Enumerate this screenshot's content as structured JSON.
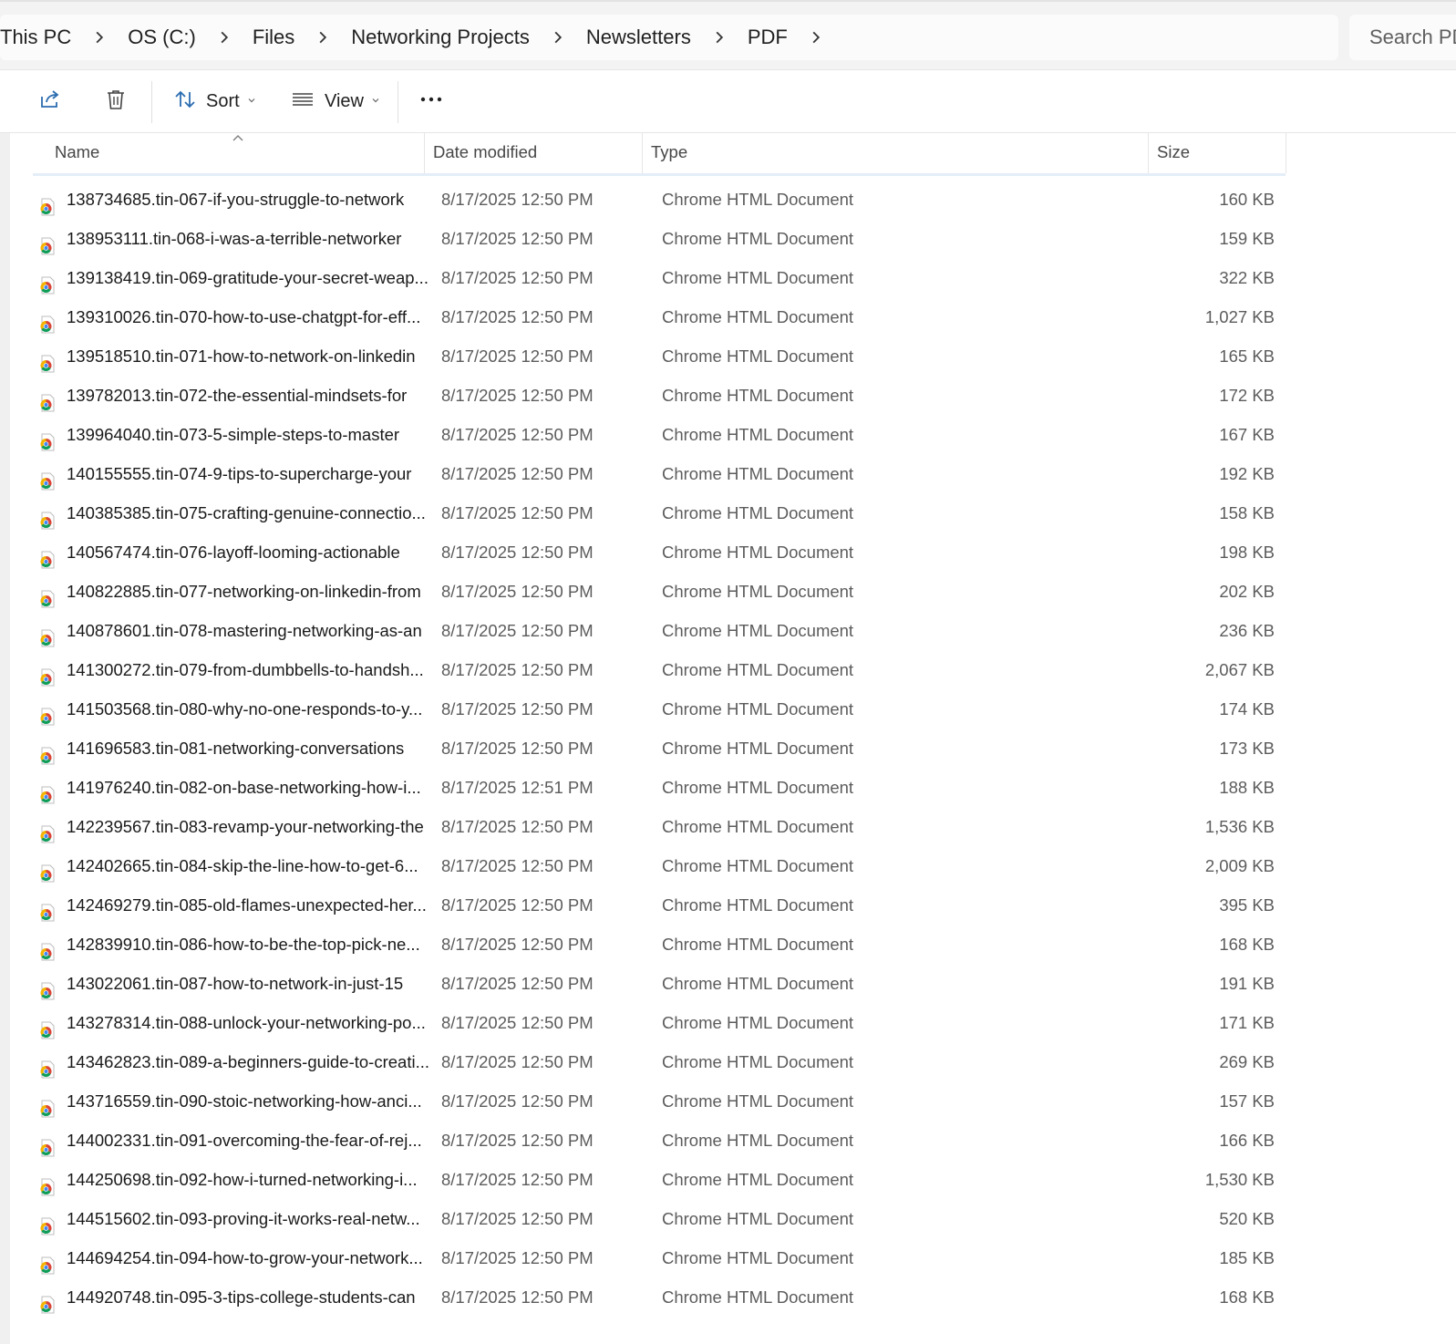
{
  "breadcrumb": [
    "This PC",
    "OS (C:)",
    "Files",
    "Networking Projects",
    "Newsletters",
    "PDF"
  ],
  "search": {
    "placeholder": "Search PDF"
  },
  "toolbar": {
    "sort_label": "Sort",
    "view_label": "View"
  },
  "columns": {
    "name": "Name",
    "date": "Date modified",
    "type": "Type",
    "size": "Size"
  },
  "files": [
    {
      "name": "138734685.tin-067-if-you-struggle-to-network",
      "date": "8/17/2025 12:50 PM",
      "type": "Chrome HTML Document",
      "size": "160 KB"
    },
    {
      "name": "138953111.tin-068-i-was-a-terrible-networker",
      "date": "8/17/2025 12:50 PM",
      "type": "Chrome HTML Document",
      "size": "159 KB"
    },
    {
      "name": "139138419.tin-069-gratitude-your-secret-weap...",
      "date": "8/17/2025 12:50 PM",
      "type": "Chrome HTML Document",
      "size": "322 KB"
    },
    {
      "name": "139310026.tin-070-how-to-use-chatgpt-for-eff...",
      "date": "8/17/2025 12:50 PM",
      "type": "Chrome HTML Document",
      "size": "1,027 KB"
    },
    {
      "name": "139518510.tin-071-how-to-network-on-linkedin",
      "date": "8/17/2025 12:50 PM",
      "type": "Chrome HTML Document",
      "size": "165 KB"
    },
    {
      "name": "139782013.tin-072-the-essential-mindsets-for",
      "date": "8/17/2025 12:50 PM",
      "type": "Chrome HTML Document",
      "size": "172 KB"
    },
    {
      "name": "139964040.tin-073-5-simple-steps-to-master",
      "date": "8/17/2025 12:50 PM",
      "type": "Chrome HTML Document",
      "size": "167 KB"
    },
    {
      "name": "140155555.tin-074-9-tips-to-supercharge-your",
      "date": "8/17/2025 12:50 PM",
      "type": "Chrome HTML Document",
      "size": "192 KB"
    },
    {
      "name": "140385385.tin-075-crafting-genuine-connectio...",
      "date": "8/17/2025 12:50 PM",
      "type": "Chrome HTML Document",
      "size": "158 KB"
    },
    {
      "name": "140567474.tin-076-layoff-looming-actionable",
      "date": "8/17/2025 12:50 PM",
      "type": "Chrome HTML Document",
      "size": "198 KB"
    },
    {
      "name": "140822885.tin-077-networking-on-linkedin-from",
      "date": "8/17/2025 12:50 PM",
      "type": "Chrome HTML Document",
      "size": "202 KB"
    },
    {
      "name": "140878601.tin-078-mastering-networking-as-an",
      "date": "8/17/2025 12:50 PM",
      "type": "Chrome HTML Document",
      "size": "236 KB"
    },
    {
      "name": "141300272.tin-079-from-dumbbells-to-handsh...",
      "date": "8/17/2025 12:50 PM",
      "type": "Chrome HTML Document",
      "size": "2,067 KB"
    },
    {
      "name": "141503568.tin-080-why-no-one-responds-to-y...",
      "date": "8/17/2025 12:50 PM",
      "type": "Chrome HTML Document",
      "size": "174 KB"
    },
    {
      "name": "141696583.tin-081-networking-conversations",
      "date": "8/17/2025 12:50 PM",
      "type": "Chrome HTML Document",
      "size": "173 KB"
    },
    {
      "name": "141976240.tin-082-on-base-networking-how-i...",
      "date": "8/17/2025 12:51 PM",
      "type": "Chrome HTML Document",
      "size": "188 KB"
    },
    {
      "name": "142239567.tin-083-revamp-your-networking-the",
      "date": "8/17/2025 12:50 PM",
      "type": "Chrome HTML Document",
      "size": "1,536 KB"
    },
    {
      "name": "142402665.tin-084-skip-the-line-how-to-get-6...",
      "date": "8/17/2025 12:50 PM",
      "type": "Chrome HTML Document",
      "size": "2,009 KB"
    },
    {
      "name": "142469279.tin-085-old-flames-unexpected-her...",
      "date": "8/17/2025 12:50 PM",
      "type": "Chrome HTML Document",
      "size": "395 KB"
    },
    {
      "name": "142839910.tin-086-how-to-be-the-top-pick-ne...",
      "date": "8/17/2025 12:50 PM",
      "type": "Chrome HTML Document",
      "size": "168 KB"
    },
    {
      "name": "143022061.tin-087-how-to-network-in-just-15",
      "date": "8/17/2025 12:50 PM",
      "type": "Chrome HTML Document",
      "size": "191 KB"
    },
    {
      "name": "143278314.tin-088-unlock-your-networking-po...",
      "date": "8/17/2025 12:50 PM",
      "type": "Chrome HTML Document",
      "size": "171 KB"
    },
    {
      "name": "143462823.tin-089-a-beginners-guide-to-creati...",
      "date": "8/17/2025 12:50 PM",
      "type": "Chrome HTML Document",
      "size": "269 KB"
    },
    {
      "name": "143716559.tin-090-stoic-networking-how-anci...",
      "date": "8/17/2025 12:50 PM",
      "type": "Chrome HTML Document",
      "size": "157 KB"
    },
    {
      "name": "144002331.tin-091-overcoming-the-fear-of-rej...",
      "date": "8/17/2025 12:50 PM",
      "type": "Chrome HTML Document",
      "size": "166 KB"
    },
    {
      "name": "144250698.tin-092-how-i-turned-networking-i...",
      "date": "8/17/2025 12:50 PM",
      "type": "Chrome HTML Document",
      "size": "1,530 KB"
    },
    {
      "name": "144515602.tin-093-proving-it-works-real-netw...",
      "date": "8/17/2025 12:50 PM",
      "type": "Chrome HTML Document",
      "size": "520 KB"
    },
    {
      "name": "144694254.tin-094-how-to-grow-your-network...",
      "date": "8/17/2025 12:50 PM",
      "type": "Chrome HTML Document",
      "size": "185 KB"
    },
    {
      "name": "144920748.tin-095-3-tips-college-students-can",
      "date": "8/17/2025 12:50 PM",
      "type": "Chrome HTML Document",
      "size": "168 KB"
    }
  ],
  "icons": {
    "file": "chrome-html-file-icon",
    "share": "share-icon",
    "delete": "trash-icon",
    "sort": "sort-arrows-icon",
    "view": "view-list-icon",
    "more": "more-dots-icon",
    "separator": "chevron-right-icon"
  }
}
